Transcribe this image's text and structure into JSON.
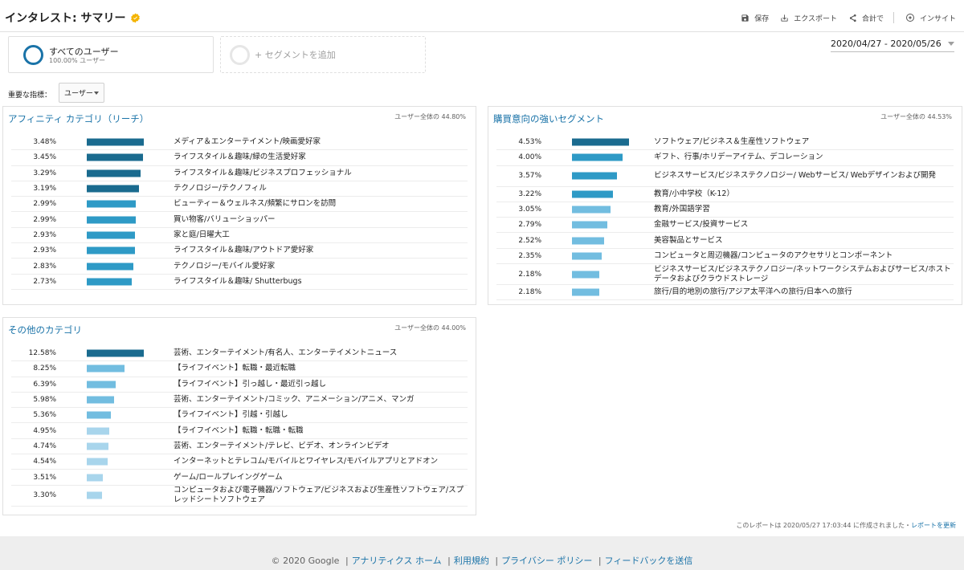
{
  "header": {
    "title": "インタレスト: サマリー",
    "actions": {
      "save": "保存",
      "export": "エクスポート",
      "share": "合計で",
      "insight": "インサイト"
    }
  },
  "segments": {
    "all_users": {
      "name": "すべてのユーザー",
      "sub": "100.00% ユーザー"
    },
    "add": "+ セグメントを追加"
  },
  "date_range": "2020/04/27 - 2020/05/26",
  "metric": {
    "label": "重要な指標：",
    "value": "ユーザー"
  },
  "colors": {
    "accent": "#1a73a8",
    "bar_dark": "#1a6b8f",
    "bar_mid": "#2e9ac6",
    "bar_light": "#72bde0",
    "bar_lighter": "#a8d5ec"
  },
  "panels": {
    "affinity": {
      "title": "アフィニティ カテゴリ（リーチ）",
      "total": "ユーザー全体の 44.80%",
      "rows": [
        {
          "pct": "3.48%",
          "label": "メディア＆エンターテイメント/映画愛好家"
        },
        {
          "pct": "3.45%",
          "label": "ライフスタイル＆趣味/緑の生活愛好家"
        },
        {
          "pct": "3.29%",
          "label": "ライフスタイル＆趣味/ビジネスプロフェッショナル"
        },
        {
          "pct": "3.19%",
          "label": "テクノロジー/テクノフィル"
        },
        {
          "pct": "2.99%",
          "label": "ビューティー＆ウェルネス/頻繁にサロンを訪問"
        },
        {
          "pct": "2.99%",
          "label": "買い物客/バリューショッパー"
        },
        {
          "pct": "2.93%",
          "label": "家と庭/日曜大工"
        },
        {
          "pct": "2.93%",
          "label": "ライフスタイル＆趣味/アウトドア愛好家"
        },
        {
          "pct": "2.83%",
          "label": "テクノロジー/モバイル愛好家"
        },
        {
          "pct": "2.73%",
          "label": "ライフスタイル＆趣味/ Shutterbugs"
        }
      ]
    },
    "in_market": {
      "title": "購買意向の強いセグメント",
      "total": "ユーザー全体の 44.53%",
      "rows": [
        {
          "pct": "4.53%",
          "label": "ソフトウェア/ビジネス＆生産性ソフトウェア"
        },
        {
          "pct": "4.00%",
          "label": "ギフト、行事/ホリデーアイテム、デコレーション"
        },
        {
          "pct": "3.57%",
          "label": "ビジネスサービス/ビジネステクノロジー/ Webサービス/ Webデザインおよび開発"
        },
        {
          "pct": "3.22%",
          "label": "教育/小中学校（K-12）"
        },
        {
          "pct": "3.05%",
          "label": "教育/外国語学習"
        },
        {
          "pct": "2.79%",
          "label": "金融サービス/投資サービス"
        },
        {
          "pct": "2.52%",
          "label": "美容製品とサービス"
        },
        {
          "pct": "2.35%",
          "label": "コンピュータと周辺機器/コンピュータのアクセサリとコンポーネント"
        },
        {
          "pct": "2.18%",
          "label": "ビジネスサービス/ビジネステクノロジー/ネットワークシステムおよびサービス/ホストデータおよびクラウドストレージ"
        },
        {
          "pct": "2.18%",
          "label": "旅行/目的地別の旅行/アジア太平洋への旅行/日本への旅行"
        }
      ]
    },
    "other": {
      "title": "その他のカテゴリ",
      "total": "ユーザー全体の 44.00%",
      "rows": [
        {
          "pct": "12.58%",
          "label": "芸術、エンターテイメント/有名人、エンターテイメントニュース"
        },
        {
          "pct": "8.25%",
          "label": "【ライフイベント】転職・最近転職"
        },
        {
          "pct": "6.39%",
          "label": "【ライフイベント】引っ越し・最近引っ越し"
        },
        {
          "pct": "5.98%",
          "label": "芸術、エンターテイメント/コミック、アニメーション/アニメ、マンガ"
        },
        {
          "pct": "5.36%",
          "label": "【ライフイベント】引越・引越し"
        },
        {
          "pct": "4.95%",
          "label": "【ライフイベント】転職・転職・転職"
        },
        {
          "pct": "4.74%",
          "label": "芸術、エンターテイメント/テレビ、ビデオ、オンラインビデオ"
        },
        {
          "pct": "4.54%",
          "label": "インターネットとテレコム/モバイルとワイヤレス/モバイルアプリとアドオン"
        },
        {
          "pct": "3.51%",
          "label": "ゲーム/ロールプレイングゲーム"
        },
        {
          "pct": "3.30%",
          "label": "コンピュータおよび電子機器/ソフトウェア/ビジネスおよび生産性ソフトウェア/スプレッドシートソフトウェア"
        }
      ]
    }
  },
  "report_note": {
    "text": "このレポートは 2020/05/27 17:03:44 に作成されました・",
    "link": "レポートを更新"
  },
  "footer": {
    "copyright": "© 2020 Google",
    "links": [
      "アナリティクス ホーム",
      "利用規約",
      "プライバシー ポリシー",
      "フィードバックを送信"
    ]
  }
}
